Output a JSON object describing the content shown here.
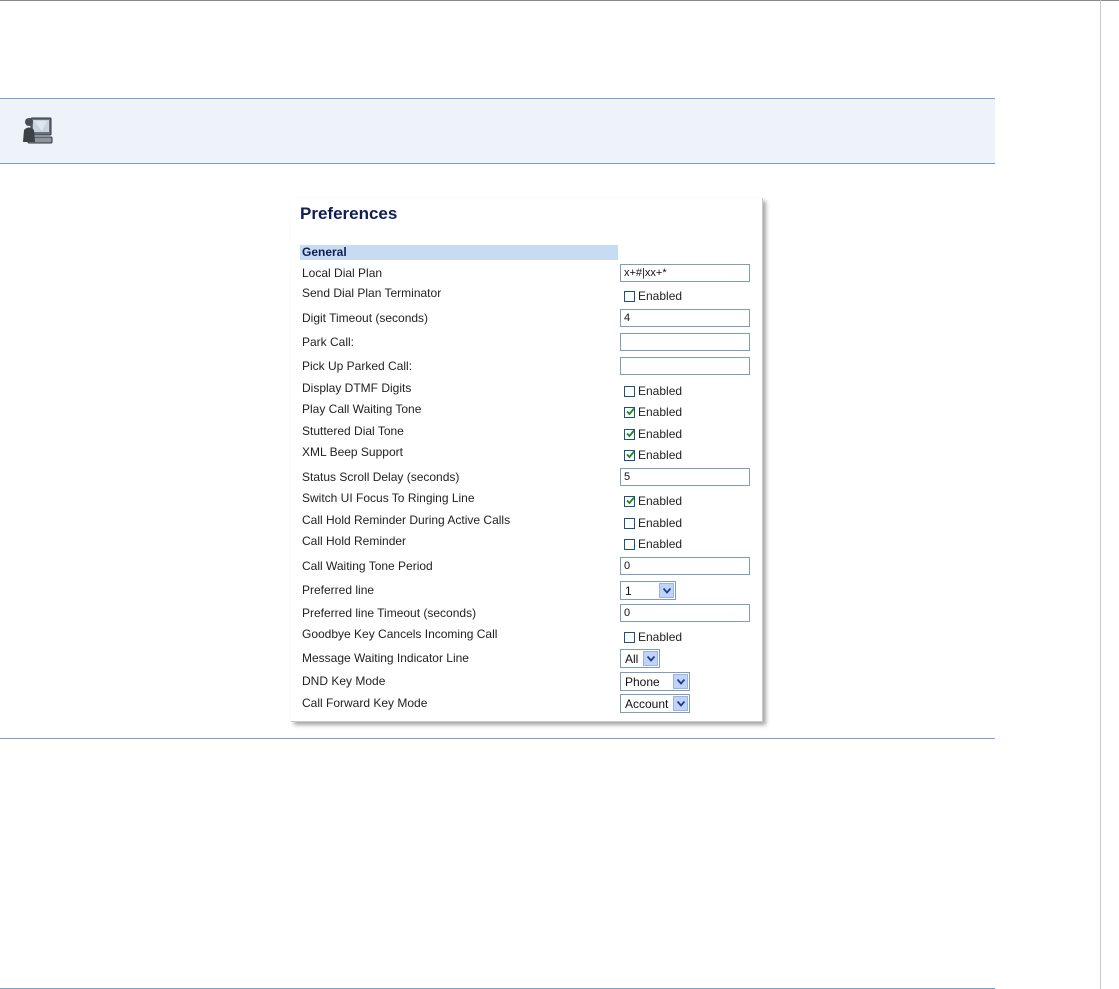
{
  "page": {
    "title": "Preferences",
    "section": "General"
  },
  "rows": [
    {
      "label": "Local Dial Plan",
      "type": "text",
      "value": "x+#|xx+*"
    },
    {
      "label": "Send Dial Plan Terminator",
      "type": "check",
      "checked": false,
      "check_label": "Enabled"
    },
    {
      "label": "Digit Timeout (seconds)",
      "type": "text",
      "value": "4"
    },
    {
      "label": "Park Call:",
      "type": "text",
      "value": ""
    },
    {
      "label": "Pick Up Parked Call:",
      "type": "text",
      "value": ""
    },
    {
      "label": "Display DTMF Digits",
      "type": "check",
      "checked": false,
      "check_label": "Enabled"
    },
    {
      "label": "Play Call Waiting Tone",
      "type": "check",
      "checked": true,
      "check_label": "Enabled"
    },
    {
      "label": "Stuttered Dial Tone",
      "type": "check",
      "checked": true,
      "check_label": "Enabled"
    },
    {
      "label": "XML Beep Support",
      "type": "check",
      "checked": true,
      "check_label": "Enabled"
    },
    {
      "label": "Status Scroll Delay (seconds)",
      "type": "text",
      "value": "5"
    },
    {
      "label": "Switch UI Focus To Ringing Line",
      "type": "check",
      "checked": true,
      "check_label": "Enabled"
    },
    {
      "label": "Call Hold Reminder During Active Calls",
      "type": "check",
      "checked": false,
      "check_label": "Enabled"
    },
    {
      "label": "Call Hold Reminder",
      "type": "check",
      "checked": false,
      "check_label": "Enabled"
    },
    {
      "label": "Call Waiting Tone Period",
      "type": "text",
      "value": "0"
    },
    {
      "label": "Preferred line",
      "type": "select",
      "value": "1"
    },
    {
      "label": "Preferred line Timeout (seconds)",
      "type": "text",
      "value": "0"
    },
    {
      "label": "Goodbye Key Cancels Incoming Call",
      "type": "check",
      "checked": false,
      "check_label": "Enabled"
    },
    {
      "label": "Message Waiting Indicator Line",
      "type": "select",
      "value": "All"
    },
    {
      "label": "DND Key Mode",
      "type": "select",
      "value": "Phone"
    },
    {
      "label": "Call Forward Key Mode",
      "type": "select",
      "value": "Account"
    }
  ],
  "icons": {
    "banner": "computer-user-icon",
    "dropdown": "chevron-down-icon",
    "checkmark": "checkmark-icon"
  },
  "colors": {
    "title": "#0f1f56",
    "section_bg": "#c7dcf2",
    "banner_bg": "#eef3fa",
    "rule": "#7aa3c9",
    "check": "#1a8a1a"
  }
}
